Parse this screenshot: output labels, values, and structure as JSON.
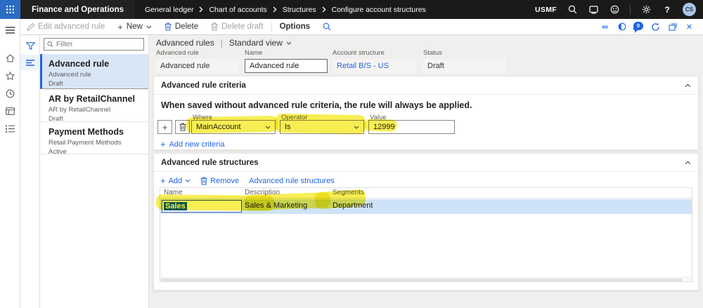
{
  "colors": {
    "accent": "#2266E3",
    "topbar_bg": "#1b1a19",
    "waffle_bg": "#2a6bc4",
    "marker_highlight": "#f4e712",
    "selected_item_bg": "#d8e6f6",
    "selected_row_bg": "#cfe3f8",
    "avatar_bg": "#a9c7e9"
  },
  "icons": {
    "plus": "+",
    "close": "✕",
    "infinity": "∞",
    "help": "?"
  },
  "topbar": {
    "app_name": "Finance and Operations",
    "breadcrumbs": [
      "General ledger",
      "Chart of accounts",
      "Structures",
      "Configure account structures"
    ],
    "company": "USMF",
    "avatar_initials": "CS",
    "messages_count": "0"
  },
  "action_pane": {
    "edit_label": "Edit advanced rule",
    "new_label": "New",
    "delete_label": "Delete",
    "delete_draft_label": "Delete draft",
    "options_label": "Options"
  },
  "list_panel": {
    "filter_placeholder": "Filter",
    "items": [
      {
        "title": "Advanced rule",
        "subtitle": "Advanced rule",
        "status": "Draft"
      },
      {
        "title": "AR by RetailChannel",
        "subtitle": "AR by RetailChannel",
        "status": "Draft"
      },
      {
        "title": "Payment Methods",
        "subtitle": "Retail Payment Methods",
        "status": "Active"
      }
    ]
  },
  "page_header": {
    "title": "Advanced rules",
    "view": "Standard view",
    "fields": [
      {
        "label": "Advanced rule",
        "value": "Advanced rule"
      },
      {
        "label": "Name",
        "value": "Advanced rule"
      },
      {
        "label": "Account structure",
        "value": "Retail B/S - US"
      },
      {
        "label": "Status",
        "value": "Draft"
      }
    ]
  },
  "criteria": {
    "title": "Advanced rule criteria",
    "message": "When saved without advanced rule criteria, the rule will always be applied.",
    "where_label": "Where",
    "where_value": "MainAccount",
    "operator_label": "Operator",
    "operator_value": "Is",
    "value_label": "Value",
    "value_text": "12999",
    "add_link": "Add new criteria"
  },
  "structures": {
    "title": "Advanced rule structures",
    "add_label": "Add",
    "remove_label": "Remove",
    "link_label": "Advanced rule structures",
    "columns": [
      "Name",
      "Description",
      "Segments"
    ],
    "rows": [
      {
        "name": "Sales",
        "description": "Sales & Marketing",
        "segments": "Department"
      }
    ]
  }
}
